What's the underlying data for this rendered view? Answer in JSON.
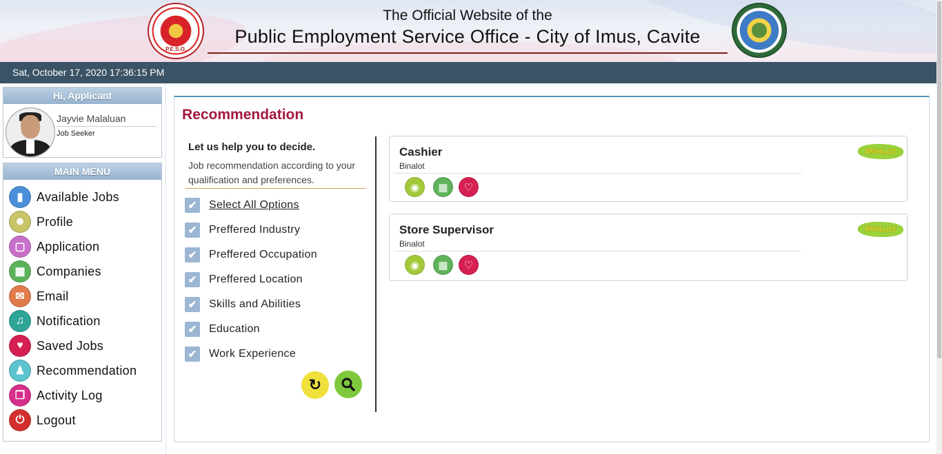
{
  "header": {
    "line1": "The Official Website of the",
    "line2": "Public Employment Service Office - City of Imus, Cavite",
    "left_logo_text": "P.E.S.O.",
    "left_logo_icon": "peso-seal-logo",
    "right_logo_icon": "lungsod-ng-imus-seal-logo"
  },
  "datetime": "Sat, October 17, 2020 17:36:15 PM",
  "user_panel": {
    "greeting": "Hi, Applicant",
    "name": "Jayvie Malaluan",
    "role": "Job Seeker"
  },
  "menu": {
    "title": "MAIN MENU",
    "items": [
      {
        "label": "Available Jobs",
        "icon": "bookmark-icon",
        "color": "#4a90d9"
      },
      {
        "label": "Profile",
        "icon": "user-icon",
        "color": "#c9c46a"
      },
      {
        "label": "Application",
        "icon": "folder-icon",
        "color": "#c86fc9"
      },
      {
        "label": "Companies",
        "icon": "building-icon",
        "color": "#5bb35a"
      },
      {
        "label": "Email",
        "icon": "envelope-icon",
        "color": "#e07b4a"
      },
      {
        "label": "Notification",
        "icon": "bell-icon",
        "color": "#2fa598"
      },
      {
        "label": "Saved Jobs",
        "icon": "heart-icon",
        "color": "#d61f52"
      },
      {
        "label": "Recommendation",
        "icon": "recommend-icon",
        "color": "#5cc4cf"
      },
      {
        "label": "Activity Log",
        "icon": "activity-log-icon",
        "color": "#d62f8c"
      },
      {
        "label": "Logout",
        "icon": "power-icon",
        "color": "#d32f2f"
      }
    ]
  },
  "main": {
    "title": "Recommendation",
    "help_title": "Let us help you to decide.",
    "help_text": "Job recommendation according to your qualification and preferences.",
    "options": [
      {
        "label": "Select All Options",
        "checked": true
      },
      {
        "label": "Preffered Industry",
        "checked": true
      },
      {
        "label": "Preffered Occupation",
        "checked": true
      },
      {
        "label": "Preffered Location",
        "checked": true
      },
      {
        "label": "Skills and Abilities",
        "checked": true
      },
      {
        "label": "Education",
        "checked": true
      },
      {
        "label": "Work Experience",
        "checked": true
      }
    ],
    "refresh_icon": "refresh-icon",
    "search_icon": "search-icon",
    "jobs": [
      {
        "title": "Cashier",
        "company": "Binalot",
        "logo_text": "BINALOT"
      },
      {
        "title": "Store Supervisor",
        "company": "Binalot",
        "logo_text": "BINALOT"
      }
    ]
  },
  "colors": {
    "datebar": "#3a5366",
    "title": "#a3183a",
    "checkbox": "#9cb6d3"
  }
}
